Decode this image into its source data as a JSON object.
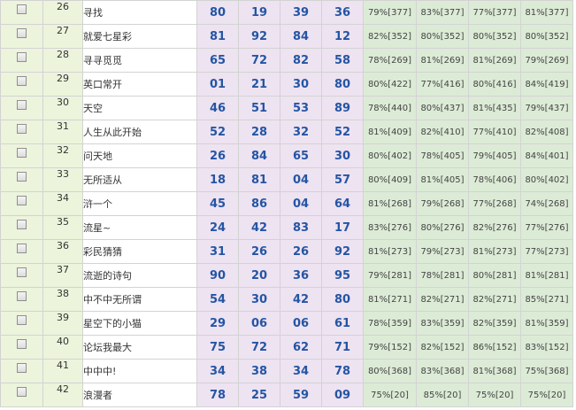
{
  "rows": [
    {
      "no": "26",
      "name": "寻找",
      "nums": [
        "80",
        "19",
        "39",
        "36"
      ],
      "pct": [
        "79%[377]",
        "83%[377]",
        "77%[377]",
        "81%[377]"
      ]
    },
    {
      "no": "27",
      "name": "就爱七星彩",
      "nums": [
        "81",
        "92",
        "84",
        "12"
      ],
      "pct": [
        "82%[352]",
        "80%[352]",
        "80%[352]",
        "80%[352]"
      ]
    },
    {
      "no": "28",
      "name": "寻寻觅觅",
      "nums": [
        "65",
        "72",
        "82",
        "58"
      ],
      "pct": [
        "78%[269]",
        "81%[269]",
        "81%[269]",
        "79%[269]"
      ]
    },
    {
      "no": "29",
      "name": "英口常开",
      "nums": [
        "01",
        "21",
        "30",
        "80"
      ],
      "pct": [
        "80%[422]",
        "77%[416]",
        "80%[416]",
        "84%[419]"
      ]
    },
    {
      "no": "30",
      "name": "天空",
      "nums": [
        "46",
        "51",
        "53",
        "89"
      ],
      "pct": [
        "78%[440]",
        "80%[437]",
        "81%[435]",
        "79%[437]"
      ]
    },
    {
      "no": "31",
      "name": "人生从此开始",
      "nums": [
        "52",
        "28",
        "32",
        "52"
      ],
      "pct": [
        "81%[409]",
        "82%[410]",
        "77%[410]",
        "82%[408]"
      ]
    },
    {
      "no": "32",
      "name": "问天地",
      "nums": [
        "26",
        "84",
        "65",
        "30"
      ],
      "pct": [
        "80%[402]",
        "78%[405]",
        "79%[405]",
        "84%[401]"
      ]
    },
    {
      "no": "33",
      "name": "无所适从",
      "nums": [
        "18",
        "81",
        "04",
        "57"
      ],
      "pct": [
        "80%[409]",
        "81%[405]",
        "78%[406]",
        "80%[402]"
      ]
    },
    {
      "no": "34",
      "name": "浒一个",
      "nums": [
        "45",
        "86",
        "04",
        "64"
      ],
      "pct": [
        "81%[268]",
        "79%[268]",
        "77%[268]",
        "74%[268]"
      ]
    },
    {
      "no": "35",
      "name": "流星~",
      "nums": [
        "24",
        "42",
        "83",
        "17"
      ],
      "pct": [
        "83%[276]",
        "80%[276]",
        "82%[276]",
        "77%[276]"
      ]
    },
    {
      "no": "36",
      "name": "彩民猜猜",
      "nums": [
        "31",
        "26",
        "26",
        "92"
      ],
      "pct": [
        "81%[273]",
        "79%[273]",
        "81%[273]",
        "77%[273]"
      ]
    },
    {
      "no": "37",
      "name": "流逝的诗句",
      "nums": [
        "90",
        "20",
        "36",
        "95"
      ],
      "pct": [
        "79%[281]",
        "78%[281]",
        "80%[281]",
        "81%[281]"
      ]
    },
    {
      "no": "38",
      "name": "中不中无所谓",
      "nums": [
        "54",
        "30",
        "42",
        "80"
      ],
      "pct": [
        "81%[271]",
        "82%[271]",
        "82%[271]",
        "85%[271]"
      ]
    },
    {
      "no": "39",
      "name": "星空下的小猫",
      "nums": [
        "29",
        "06",
        "06",
        "61"
      ],
      "pct": [
        "78%[359]",
        "83%[359]",
        "82%[359]",
        "81%[359]"
      ]
    },
    {
      "no": "40",
      "name": "论坛我最大",
      "nums": [
        "75",
        "72",
        "62",
        "71"
      ],
      "pct": [
        "79%[152]",
        "82%[152]",
        "86%[152]",
        "83%[152]"
      ]
    },
    {
      "no": "41",
      "name": "中中中!",
      "nums": [
        "34",
        "38",
        "34",
        "78"
      ],
      "pct": [
        "80%[368]",
        "83%[368]",
        "81%[368]",
        "75%[368]"
      ]
    },
    {
      "no": "42",
      "name": "浪漫者",
      "nums": [
        "78",
        "25",
        "59",
        "09"
      ],
      "pct": [
        "75%[20]",
        "85%[20]",
        "75%[20]",
        "75%[20]"
      ]
    }
  ]
}
